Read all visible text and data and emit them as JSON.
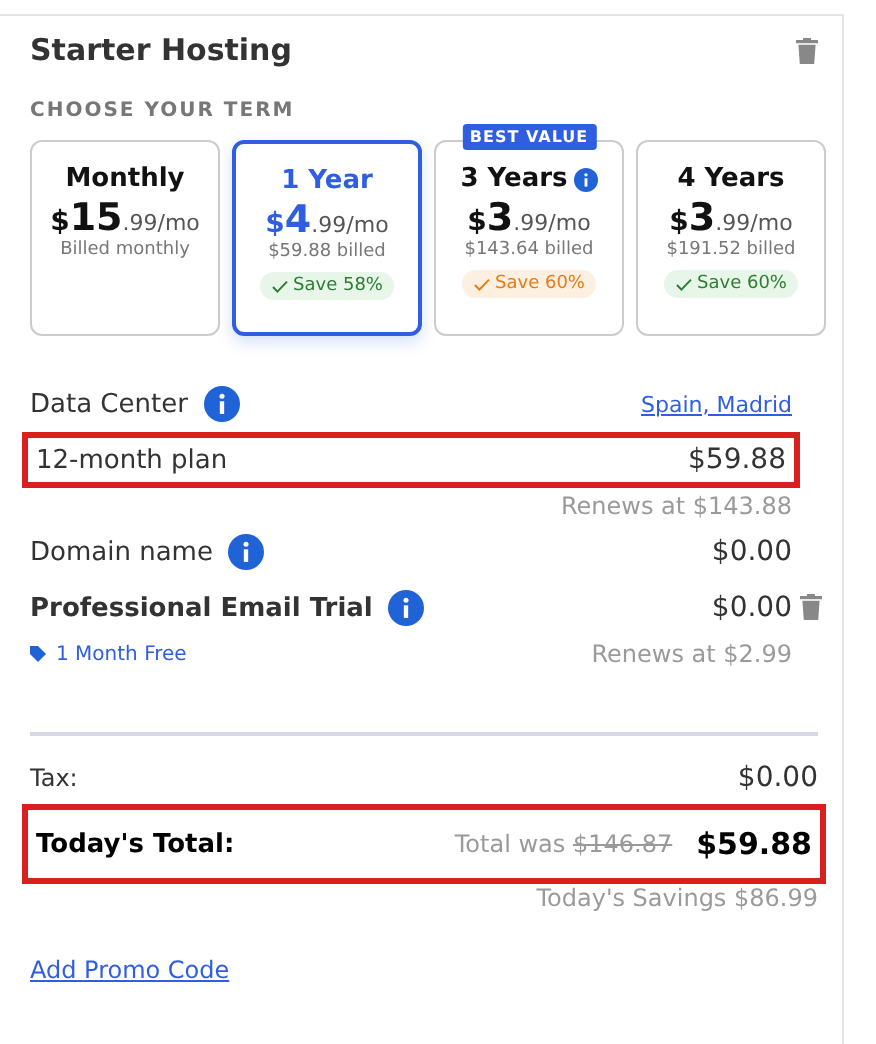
{
  "title": "Starter Hosting",
  "term_label": "CHOOSE YOUR TERM",
  "plans": [
    {
      "name": "Monthly",
      "selected": false,
      "price": {
        "currency": "$",
        "whole": "15",
        "rest": ".99/mo"
      },
      "billed": "Billed monthly",
      "info": false
    },
    {
      "name": "1 Year",
      "selected": true,
      "price": {
        "currency": "$",
        "whole": "4",
        "rest": ".99/mo"
      },
      "billed": "$59.88 billed",
      "info": false,
      "save": {
        "text": "Save 58%",
        "kind": "green"
      }
    },
    {
      "name": "3 Years",
      "selected": false,
      "badge": "BEST VALUE",
      "price": {
        "currency": "$",
        "whole": "3",
        "rest": ".99/mo"
      },
      "billed": "$143.64 billed",
      "info": true,
      "save": {
        "text": "Save 60%",
        "kind": "orange"
      }
    },
    {
      "name": "4 Years",
      "selected": false,
      "price": {
        "currency": "$",
        "whole": "3",
        "rest": ".99/mo"
      },
      "billed": "$191.52 billed",
      "info": false,
      "save": {
        "text": "Save 60%",
        "kind": "green"
      }
    }
  ],
  "lines": [
    {
      "label": "Data Center",
      "info": true,
      "bold": false,
      "highlighted": false,
      "removable": false,
      "link": "Spain, Madrid"
    },
    {
      "label": "12-month plan",
      "info": false,
      "bold": false,
      "highlighted": true,
      "removable": false,
      "amount": "$59.88",
      "renews": "Renews at $143.88"
    },
    {
      "label": "Domain name",
      "info": true,
      "bold": false,
      "highlighted": false,
      "removable": false,
      "amount": "$0.00"
    },
    {
      "label": "Professional Email Trial",
      "info": true,
      "bold": true,
      "highlighted": false,
      "amount": "$0.00",
      "removable": true,
      "tag": "1 Month Free",
      "renews": "Renews at $2.99"
    }
  ],
  "tax": {
    "label": "Tax:",
    "amount": "$0.00"
  },
  "total": {
    "label": "Today's Total:",
    "was_label": "Total was",
    "was": "$146.87",
    "amount": "$59.88",
    "highlighted": true
  },
  "savings": "Today's Savings $86.99",
  "promo": "Add Promo Code"
}
